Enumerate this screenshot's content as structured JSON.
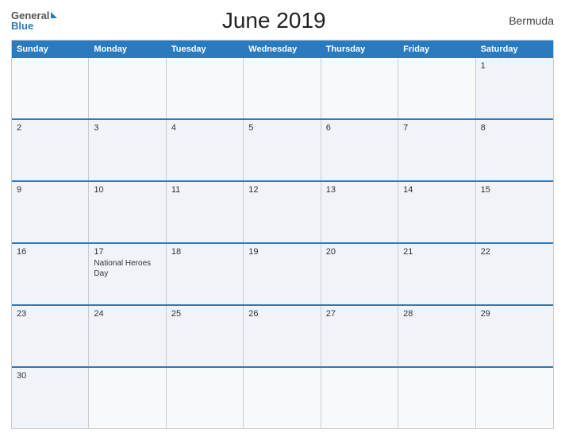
{
  "header": {
    "title": "June 2019",
    "region": "Bermuda"
  },
  "logo": {
    "general": "General",
    "blue": "Blue"
  },
  "dayHeaders": [
    "Sunday",
    "Monday",
    "Tuesday",
    "Wednesday",
    "Thursday",
    "Friday",
    "Saturday"
  ],
  "weeks": [
    [
      {
        "day": "",
        "holiday": ""
      },
      {
        "day": "",
        "holiday": ""
      },
      {
        "day": "",
        "holiday": ""
      },
      {
        "day": "",
        "holiday": ""
      },
      {
        "day": "",
        "holiday": ""
      },
      {
        "day": "",
        "holiday": ""
      },
      {
        "day": "1",
        "holiday": ""
      }
    ],
    [
      {
        "day": "2",
        "holiday": ""
      },
      {
        "day": "3",
        "holiday": ""
      },
      {
        "day": "4",
        "holiday": ""
      },
      {
        "day": "5",
        "holiday": ""
      },
      {
        "day": "6",
        "holiday": ""
      },
      {
        "day": "7",
        "holiday": ""
      },
      {
        "day": "8",
        "holiday": ""
      }
    ],
    [
      {
        "day": "9",
        "holiday": ""
      },
      {
        "day": "10",
        "holiday": ""
      },
      {
        "day": "11",
        "holiday": ""
      },
      {
        "day": "12",
        "holiday": ""
      },
      {
        "day": "13",
        "holiday": ""
      },
      {
        "day": "14",
        "holiday": ""
      },
      {
        "day": "15",
        "holiday": ""
      }
    ],
    [
      {
        "day": "16",
        "holiday": ""
      },
      {
        "day": "17",
        "holiday": "National Heroes Day"
      },
      {
        "day": "18",
        "holiday": ""
      },
      {
        "day": "19",
        "holiday": ""
      },
      {
        "day": "20",
        "holiday": ""
      },
      {
        "day": "21",
        "holiday": ""
      },
      {
        "day": "22",
        "holiday": ""
      }
    ],
    [
      {
        "day": "23",
        "holiday": ""
      },
      {
        "day": "24",
        "holiday": ""
      },
      {
        "day": "25",
        "holiday": ""
      },
      {
        "day": "26",
        "holiday": ""
      },
      {
        "day": "27",
        "holiday": ""
      },
      {
        "day": "28",
        "holiday": ""
      },
      {
        "day": "29",
        "holiday": ""
      }
    ],
    [
      {
        "day": "30",
        "holiday": ""
      },
      {
        "day": "",
        "holiday": ""
      },
      {
        "day": "",
        "holiday": ""
      },
      {
        "day": "",
        "holiday": ""
      },
      {
        "day": "",
        "holiday": ""
      },
      {
        "day": "",
        "holiday": ""
      },
      {
        "day": "",
        "holiday": ""
      }
    ]
  ]
}
